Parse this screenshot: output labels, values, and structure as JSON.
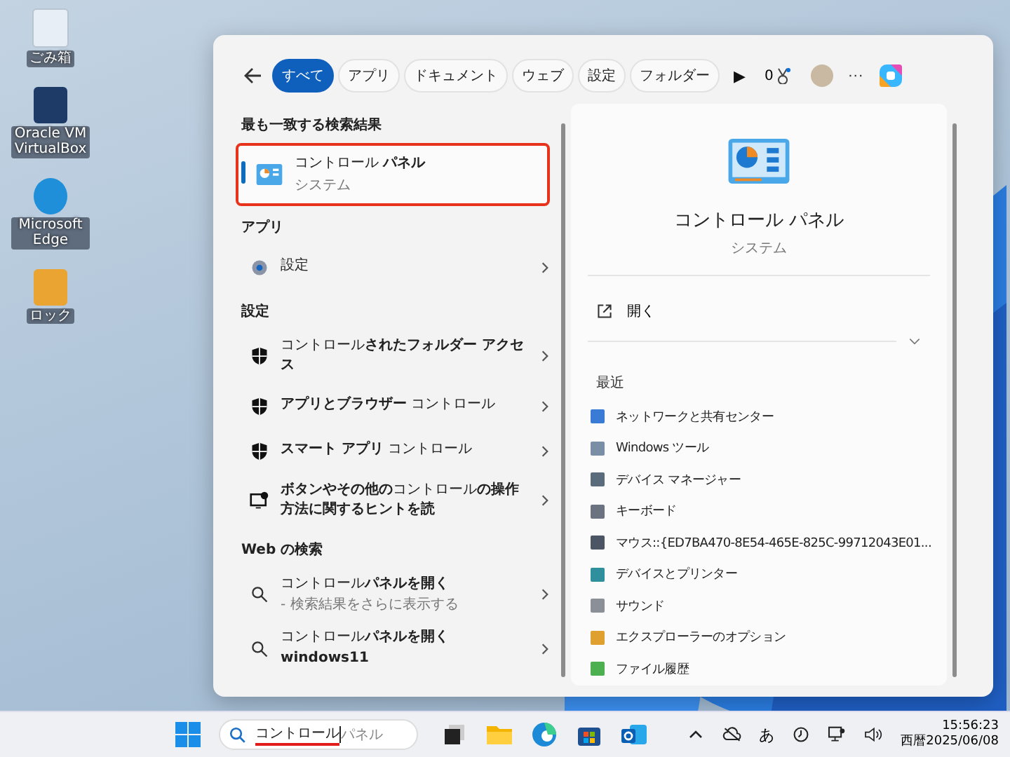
{
  "desktop_icons": [
    {
      "label": "ごみ箱"
    },
    {
      "label": "Oracle VM VirtualBox"
    },
    {
      "label": "Microsoft Edge"
    },
    {
      "label": "ロック"
    }
  ],
  "search_panel": {
    "filters": [
      {
        "label": "すべて",
        "selected": true
      },
      {
        "label": "アプリ",
        "selected": false
      },
      {
        "label": "ドキュメント",
        "selected": false
      },
      {
        "label": "ウェブ",
        "selected": false
      },
      {
        "label": "設定",
        "selected": false
      },
      {
        "label": "フォルダー",
        "selected": false
      }
    ],
    "more_filters": "▶",
    "points": "0",
    "more": "···",
    "best_match": {
      "heading": "最も一致する検索結果",
      "title": "コントロール **パネル**",
      "subtitle": "システム",
      "highlighted": true
    },
    "sections": [
      {
        "heading": "アプリ",
        "items": [
          {
            "kind": "gear",
            "title": "設定"
          }
        ]
      },
      {
        "heading": "設定",
        "items": [
          {
            "kind": "shield",
            "title": "コントロール**されたフォルダー アクセス**"
          },
          {
            "kind": "shield",
            "title": "**アプリとブラウザー** コントロール"
          },
          {
            "kind": "shield",
            "title": "**スマート アプリ** コントロール"
          },
          {
            "kind": "monitor",
            "title": "**ボタンやその他の**コントロール**の操作方法に関するヒントを読**"
          }
        ]
      },
      {
        "heading": "Web の検索",
        "items": [
          {
            "kind": "search",
            "title": "コントロール**パネルを開く**",
            "note": "- 検索結果をさらに表示する"
          },
          {
            "kind": "search",
            "title": "コントロール**パネルを開く windows11**"
          }
        ]
      }
    ],
    "detail": {
      "title": "コントロール パネル",
      "subtitle": "システム",
      "open": "開く",
      "recent_heading": "最近",
      "recent": [
        {
          "label": "ネットワークと共有センター"
        },
        {
          "label": "Windows ツール"
        },
        {
          "label": "デバイス マネージャー"
        },
        {
          "label": "キーボード"
        },
        {
          "label": "マウス::{ED7BA470-8E54-465E-825C-99712043E01..."
        },
        {
          "label": "デバイスとプリンター"
        },
        {
          "label": "サウンド"
        },
        {
          "label": "エクスプローラーのオプション"
        },
        {
          "label": "ファイル履歴"
        }
      ]
    }
  },
  "taskbar": {
    "search": {
      "value": "コントロール",
      "suggestion": "パネル"
    },
    "ime": "あ",
    "time": "15:56:23",
    "date": "西暦2025/06/08"
  }
}
